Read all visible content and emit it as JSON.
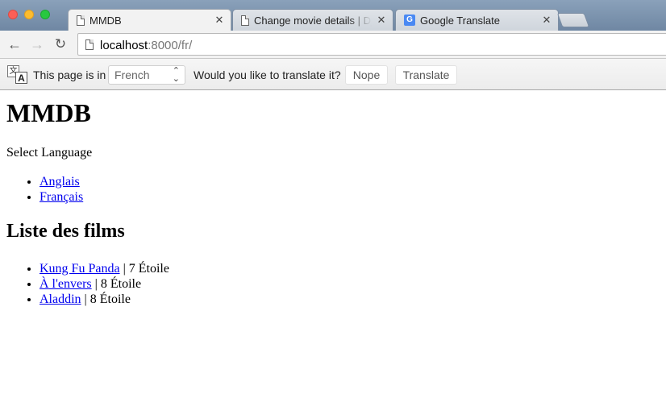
{
  "browser": {
    "tabs": [
      {
        "title": "MMDB",
        "active": true
      },
      {
        "title": "Change movie details | Django",
        "active": false
      },
      {
        "title": "Google Translate",
        "active": false
      }
    ],
    "url_host": "localhost",
    "url_path": ":8000/fr/"
  },
  "infobar": {
    "page_is_in": "This page is in",
    "language": "French",
    "question": "Would you like to translate it?",
    "nope": "Nope",
    "translate": "Translate"
  },
  "page": {
    "title": "MMDB",
    "select_language": "Select Language",
    "languages": [
      "Anglais",
      "Français"
    ],
    "films_heading": "Liste des films",
    "films": [
      {
        "title": "Kung Fu Panda",
        "rating": " | 7 Étoile"
      },
      {
        "title": "À l'envers",
        "rating": " | 8 Étoile"
      },
      {
        "title": "Aladdin",
        "rating": " | 8 Étoile"
      }
    ]
  }
}
